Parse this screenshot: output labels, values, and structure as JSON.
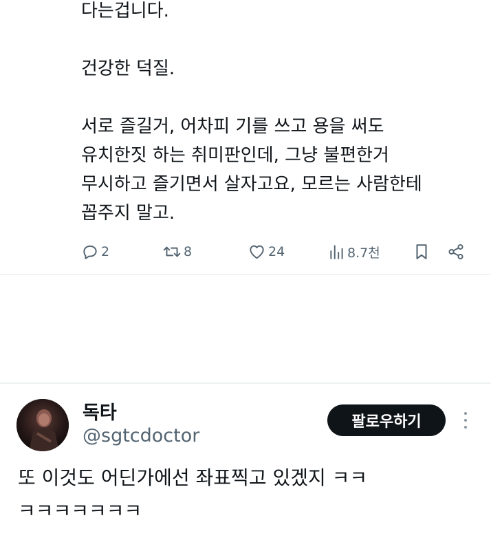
{
  "tweet1": {
    "lines": [
      "다는겁니다.",
      "건강한 덕질.",
      "서로 즐길거, 어차피 기를 쓰고 용을 써도",
      "유치한짓 하는 취미판인데, 그냥 불편한거",
      "무시하고 즐기면서 살자고요, 모르는 사람한테",
      "꼽주지 말고."
    ],
    "actions": {
      "replies": "2",
      "retweets": "8",
      "likes": "24",
      "views": "8.7천"
    },
    "icons": [
      "reply-icon",
      "retweet-icon",
      "like-icon",
      "views-icon",
      "bookmark-icon",
      "share-icon"
    ]
  },
  "tweet2": {
    "display_name": "독타",
    "handle": "@sgtcdoctor",
    "follow_label": "팔로우하기",
    "lines": [
      "또 이것도 어딘가에선 좌표찍고 있겠지 ㅋㅋ",
      "ㅋㅋㅋㅋㅋㅋㅋ"
    ],
    "icons": [
      "avatar",
      "more-options-icon"
    ]
  },
  "colors": {
    "text": "#0f1419",
    "secondary": "#536471",
    "divider": "#eff3f4",
    "button_bg": "#0f1419",
    "button_text": "#ffffff"
  }
}
